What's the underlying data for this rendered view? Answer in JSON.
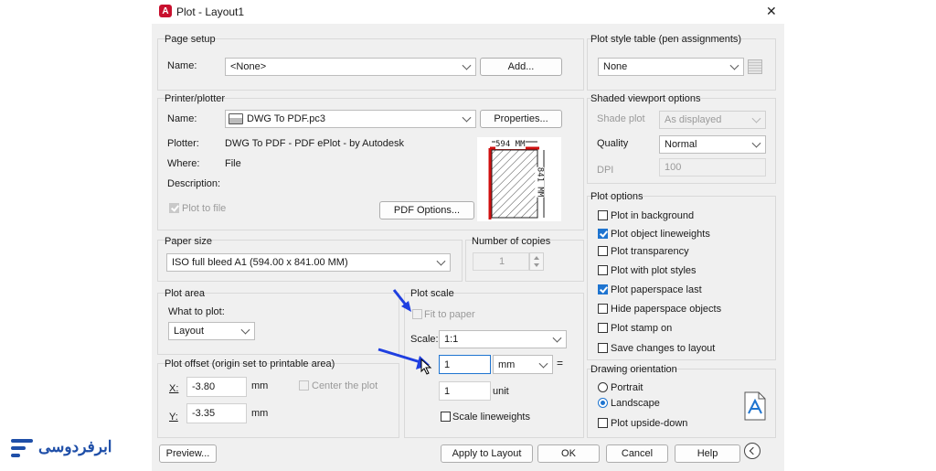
{
  "dialog": {
    "title": "Plot - Layout1",
    "close_glyph": "✕"
  },
  "page_setup": {
    "title": "Page setup",
    "name_label": "Name:",
    "name_value": "<None>",
    "add_button": "Add..."
  },
  "printer": {
    "title": "Printer/plotter",
    "name_label": "Name:",
    "name_value": "DWG To PDF.pc3",
    "properties_button": "Properties...",
    "plotter_label": "Plotter:",
    "plotter_value": "DWG To PDF - PDF ePlot - by Autodesk",
    "where_label": "Where:",
    "where_value": "File",
    "description_label": "Description:",
    "plot_to_file": "Plot to file",
    "pdf_options_button": "PDF Options...",
    "preview_width": "594 MM",
    "preview_height": "841 MM"
  },
  "paper_size": {
    "title": "Paper size",
    "value": "ISO full bleed A1 (594.00 x 841.00 MM)"
  },
  "copies": {
    "title": "Number of copies",
    "value": "1"
  },
  "plot_area": {
    "title": "Plot area",
    "what_label": "What to plot:",
    "what_value": "Layout"
  },
  "plot_offset": {
    "title": "Plot offset (origin set to printable area)",
    "x_label": "X:",
    "x_value": "-3.80",
    "x_unit": "mm",
    "y_label": "Y:",
    "y_value": "-3.35",
    "y_unit": "mm",
    "center": "Center the plot"
  },
  "plot_scale": {
    "title": "Plot scale",
    "fit": "Fit to paper",
    "scale_label": "Scale:",
    "scale_value": "1:1",
    "value1": "1",
    "unit1": "mm",
    "equals": "=",
    "value2": "1",
    "unit2": "unit",
    "scale_lineweights": "Scale lineweights"
  },
  "plot_style": {
    "title": "Plot style table (pen assignments)",
    "value": "None"
  },
  "shaded": {
    "title": "Shaded viewport options",
    "shade_label": "Shade plot",
    "shade_value": "As displayed",
    "quality_label": "Quality",
    "quality_value": "Normal",
    "dpi_label": "DPI",
    "dpi_value": "100"
  },
  "plot_options": {
    "title": "Plot options",
    "items": [
      {
        "label": "Plot in background",
        "checked": false
      },
      {
        "label": "Plot object lineweights",
        "checked": true
      },
      {
        "label": "Plot transparency",
        "checked": false
      },
      {
        "label": "Plot with plot styles",
        "checked": false
      },
      {
        "label": "Plot paperspace last",
        "checked": true
      },
      {
        "label": "Hide paperspace objects",
        "checked": false
      },
      {
        "label": "Plot stamp on",
        "checked": false
      },
      {
        "label": "Save changes to layout",
        "checked": false
      }
    ]
  },
  "orientation": {
    "title": "Drawing orientation",
    "portrait": "Portrait",
    "landscape": "Landscape",
    "upside_down": "Plot upside-down",
    "selected": "Landscape"
  },
  "footer": {
    "preview": "Preview...",
    "apply": "Apply to Layout",
    "ok": "OK",
    "cancel": "Cancel",
    "help": "Help"
  },
  "brand": {
    "text": "ابرفردوسی"
  },
  "colors": {
    "accent": "#1e74d0",
    "annotation_arrow": "#1f3fe0",
    "autocad_red": "#c8102e",
    "brand_blue": "#1f4fa8"
  }
}
